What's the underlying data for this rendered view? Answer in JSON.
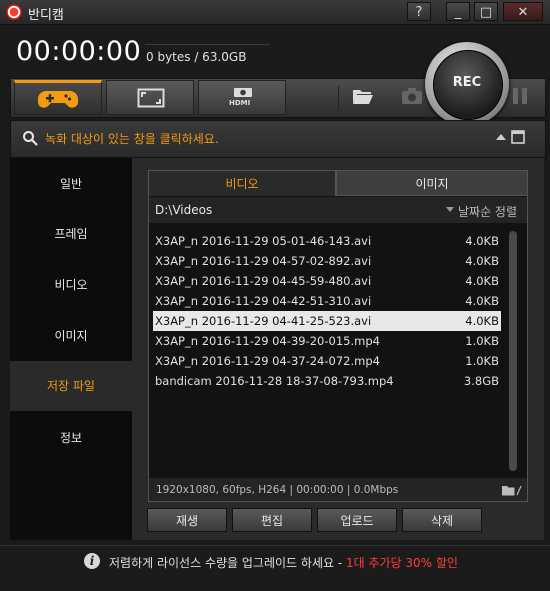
{
  "app": {
    "title": "반디캠"
  },
  "window_buttons": {
    "help": "?",
    "minimize": "_",
    "restore": "□",
    "close": "✕"
  },
  "header": {
    "timer": "00:00:00",
    "size": "0 bytes / 63.0GB"
  },
  "record_button": {
    "label": "REC"
  },
  "toolbar": {
    "modes": [
      "game-mode",
      "screen-mode",
      "hdmi-mode"
    ],
    "hdmi_label": "HDMI"
  },
  "hint": {
    "text": "녹화 대상이 있는 창을 클릭하세요."
  },
  "sidebar": {
    "items": [
      {
        "label": "일반"
      },
      {
        "label": "프레임"
      },
      {
        "label": "비디오"
      },
      {
        "label": "이미지"
      },
      {
        "label": "저장 파일"
      },
      {
        "label": "정보"
      }
    ],
    "active": "저장 파일"
  },
  "tabs": {
    "video": "비디오",
    "image": "이미지"
  },
  "folder": {
    "path": "D:\\Videos",
    "sort": "날짜순 정렬"
  },
  "files": [
    {
      "name": "X3AP_n 2016-11-29 05-01-46-143.avi",
      "size": "4.0KB"
    },
    {
      "name": "X3AP_n 2016-11-29 04-57-02-892.avi",
      "size": "4.0KB"
    },
    {
      "name": "X3AP_n 2016-11-29 04-45-59-480.avi",
      "size": "4.0KB"
    },
    {
      "name": "X3AP_n 2016-11-29 04-42-51-310.avi",
      "size": "4.0KB"
    },
    {
      "name": "X3AP_n 2016-11-29 04-41-25-523.avi",
      "size": "4.0KB",
      "selected": true
    },
    {
      "name": "X3AP_n 2016-11-29 04-39-20-015.mp4",
      "size": "1.0KB"
    },
    {
      "name": "X3AP_n 2016-11-29 04-37-24-072.mp4",
      "size": "1.0KB"
    },
    {
      "name": "bandicam 2016-11-28 18-37-08-793.mp4",
      "size": "3.8GB"
    }
  ],
  "status": {
    "text": "1920x1080, 60fps, H264 | 00:00:00 | 0.0Mbps"
  },
  "actions": {
    "play": "재생",
    "edit": "편집",
    "upload": "업로드",
    "delete": "삭제"
  },
  "footer": {
    "info": "i",
    "text": "저렴하게 라이선스 수량을 업그레이드 하세요 - ",
    "promo": "1대 추가당 30% 할인"
  },
  "colors": {
    "accent": "#f39c12",
    "promo": "#ff3b3b",
    "rec_dot": "#ff3b30"
  }
}
